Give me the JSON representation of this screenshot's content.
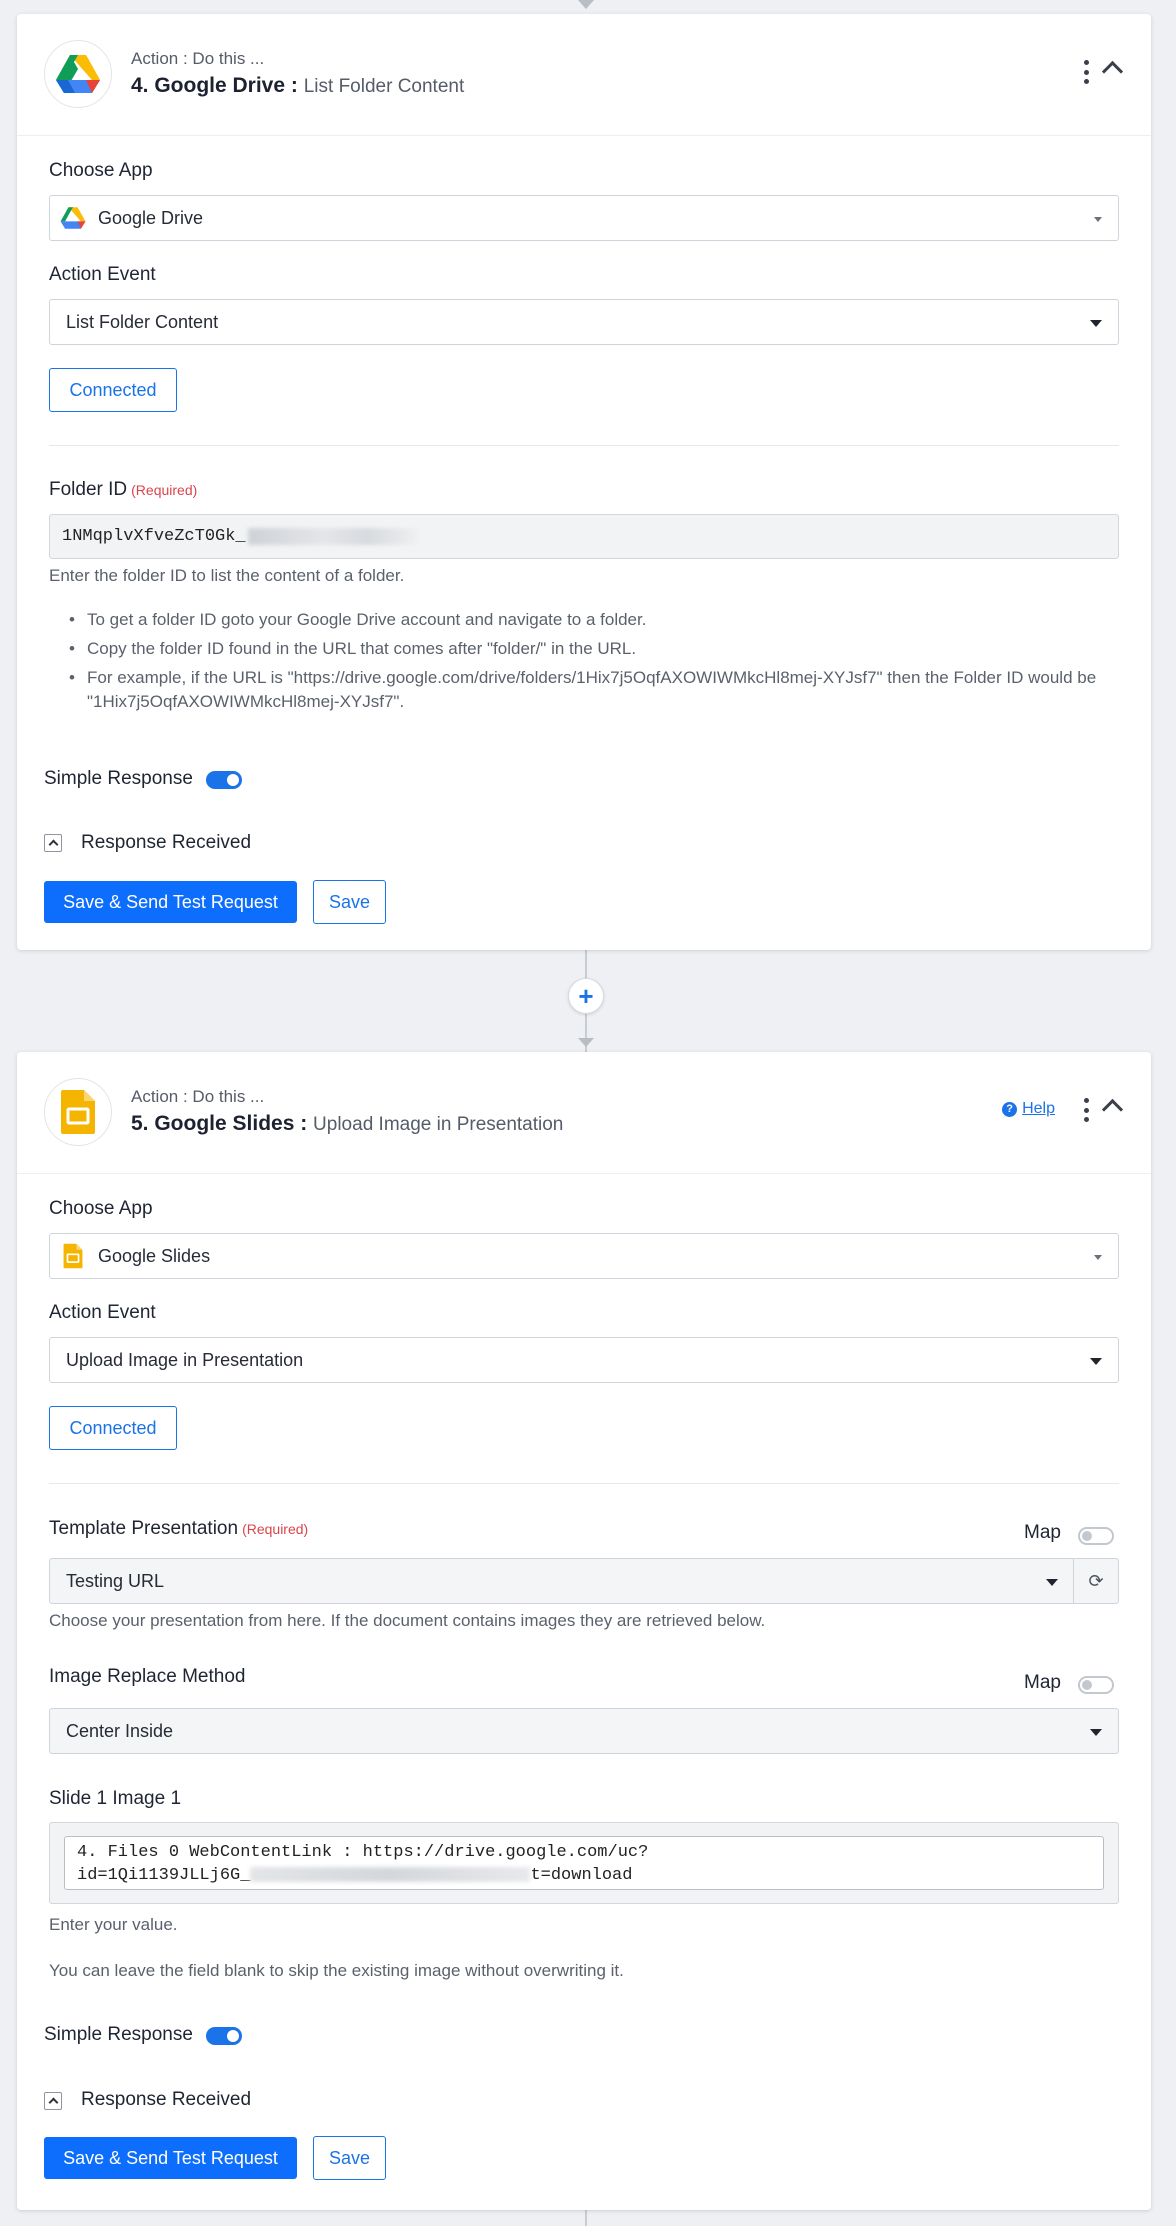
{
  "step4": {
    "kicker": "Action : Do this ...",
    "title": "4. Google Drive :",
    "event_title": "List Folder Content",
    "choose_app_label": "Choose App",
    "app_value": "Google Drive",
    "action_event_label": "Action Event",
    "action_event_value": "List Folder Content",
    "connected_label": "Connected",
    "folder_id_label": "Folder ID",
    "required": "(Required)",
    "folder_id_value": "1NMqplvXfveZcT0Gk_",
    "folder_hint": "Enter the folder ID to list the content of a folder.",
    "bullets": [
      "To get a folder ID goto your Google Drive account and navigate to a folder.",
      "Copy the folder ID found in the URL that comes after \"folder/\" in the URL.",
      "For example, if the URL is \"https://drive.google.com/drive/folders/1Hix7j5OqfAXOWIWMkcHl8mej-XYJsf7\" then the Folder ID would be \"1Hix7j5OqfAXOWIWMkcHl8mej-XYJsf7\"."
    ],
    "simple_response_label": "Simple Response",
    "simple_response_on": true,
    "response_received_label": "Response Received",
    "save_send_label": "Save & Send Test Request",
    "save_label": "Save"
  },
  "add_step_icon": "plus-icon",
  "step5": {
    "kicker": "Action : Do this ...",
    "title": "5. Google Slides :",
    "event_title": "Upload Image in Presentation",
    "help_label": "Help",
    "choose_app_label": "Choose App",
    "app_value": "Google Slides",
    "action_event_label": "Action Event",
    "action_event_value": "Upload Image in Presentation",
    "connected_label": "Connected",
    "template_label": "Template Presentation",
    "required": "(Required)",
    "map_label": "Map",
    "template_value": "Testing URL",
    "template_hint": "Choose your presentation from here. If the document contains images they are retrieved below.",
    "replace_method_label": "Image Replace Method",
    "replace_method_value": "Center Inside",
    "slide_image_label": "Slide 1 Image 1",
    "slide_image_line1": "4. Files 0 WebContentLink : https://drive.google.com/uc?",
    "slide_image_line2_a": "id=1Qi1139JLLj6G_",
    "slide_image_line2_b": "t=download",
    "enter_value_hint": "Enter your value.",
    "skip_hint": "You can leave the field blank to skip the existing image without overwriting it.",
    "simple_response_label": "Simple Response",
    "simple_response_on": true,
    "response_received_label": "Response Received",
    "save_send_label": "Save & Send Test Request",
    "save_label": "Save"
  },
  "colors": {
    "accent": "#1a73e8",
    "primary_button": "#0d6efd",
    "required": "#d9454c",
    "page_bg": "#eef0f4"
  }
}
